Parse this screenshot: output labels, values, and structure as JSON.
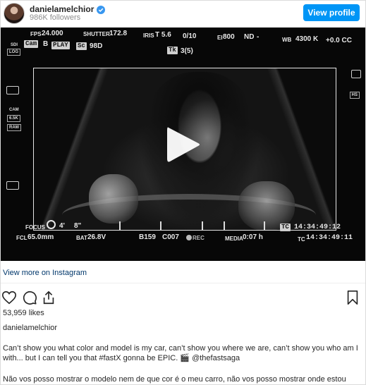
{
  "header": {
    "username": "danielamelchior",
    "followers": "986K followers",
    "view_profile_label": "View profile"
  },
  "hud": {
    "fps_label": "FPS",
    "fps_value": "24.000",
    "shutter_label": "SHUTTER",
    "shutter_value": "172.8",
    "iris_label": "IRIS",
    "iris_value": "T 5.6",
    "clip_count": "0/10",
    "ei_label": "EI",
    "ei_value": "800",
    "nd_label": "ND",
    "nd_value": "-",
    "wb_label": "WB",
    "wb_value": "4300 K",
    "cc_value": "+0.0 CC",
    "cam_box": "Cam",
    "cam_letter": "B",
    "play_box": "PLAY",
    "sc_box": "Sc",
    "sc_value": "98D",
    "tk_box": "Tk",
    "tk_value": "3(5)",
    "sdi_label": "SDI",
    "log_label": "LOG",
    "cam_side_label": "CAM",
    "res_label": "6.5K",
    "raw_label": "RAW",
    "hs_label": "HS",
    "focus_label": "FOCUS",
    "focus_value": "4'",
    "focus_value2": "8\"",
    "fcl_label": "FCL",
    "fcl_value": "65.0mm",
    "bat_label": "BAT",
    "bat_value": "26.8V",
    "reel": "B159",
    "clip": "C007",
    "rec": "REC",
    "media_label": "MEDIA",
    "media_value": "0:07 h",
    "tc_box": "TC",
    "tc_value": "14:34:49:12",
    "tc2_label": "TC",
    "tc2_value": "14:34:49:11"
  },
  "links": {
    "view_more": "View more on Instagram"
  },
  "post": {
    "likes": "53,959 likes",
    "caption_username": "danielamelchior",
    "caption_en": "Can’t show you what color and model is my car, can’t show you where we are, can’t show you who am I with... but I can tell you that #fastX gonna be EPIC. 🎬 @thefastsaga",
    "caption_pt": "Não vos posso mostrar o modelo nem de que cor é o meu carro, não vos posso mostrar onde estou"
  },
  "icons": {
    "verified": "verified-badge-icon",
    "play": "play-icon",
    "like": "heart-icon",
    "comment": "comment-icon",
    "share": "share-icon",
    "save": "bookmark-icon"
  },
  "colors": {
    "accent": "#0095f6",
    "link": "#00376b",
    "muted": "#8e8e8e",
    "text": "#262626"
  }
}
